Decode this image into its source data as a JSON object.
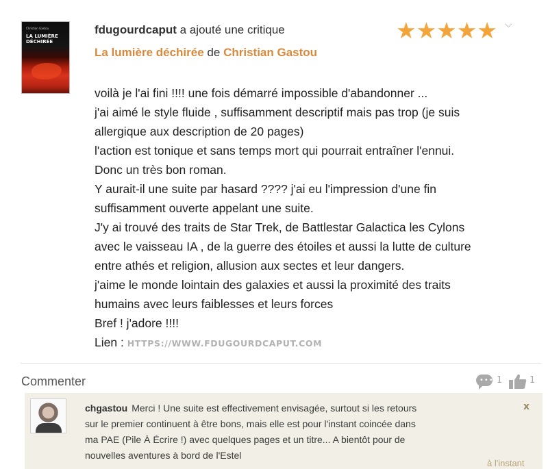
{
  "review": {
    "user": "fdugourdcaput",
    "action": "a ajouté une critique",
    "book_title": "La lumière déchirée",
    "de": "de",
    "author": "Christian Gastou",
    "rating": 5,
    "rating_max": 5,
    "stars": "★★★★★",
    "chevron": "⌵",
    "body_lines": [
      "voilà je l'ai fini !!!! une fois démarré impossible d'abandonner ...",
      "j'ai aimé le style fluide , suffisamment descriptif mais pas trop (je suis",
      "allergique aux description de 20 pages)",
      "l'action est tonique et sans temps mort qui pourrait entraîner l'ennui.",
      "Donc un très bon roman.",
      "Y aurait-il une suite par hasard ???? j'ai eu l'impression d'une fin",
      "suffisamment ouverte appelant une suite.",
      "J'y ai trouvé des traits de Star Trek, de Battlestar Galactica les Cylons",
      "avec le vaisseau IA , de la guerre des étoiles et aussi la lutte de culture",
      "entre athés et religion, allusion aux sectes et leur dangers.",
      "j'aime le monde lointain des galaxies et aussi la proximité des traits",
      "humains avec leurs faiblesses et leurs forces",
      "Bref ! j'adore !!!!"
    ],
    "link_label": "Lien :",
    "link_url": "HTTPS://WWW.FDUGOURDCAPUT.COM"
  },
  "cover": {
    "author": "Christian Gastou",
    "title": "LA LUMIÈRE DÉCHIRÉE"
  },
  "actions": {
    "comment_label": "Commenter",
    "comment_count": "1",
    "like_count": "1",
    "chat_icon": "speech-bubble-icon",
    "like_icon": "thumbs-up-icon"
  },
  "reply": {
    "author": "chgastou",
    "lines": [
      "Merci ! Une suite est effectivement envisagée, surtout si les retours",
      "sur le premier continuent à être bons, mais elle est pour l'instant coincée dans",
      "ma PAE (Pile À Écrire !) avec quelques pages et un titre... A bientôt pour de",
      "nouvelles aventures à bord de l'Estel"
    ],
    "close": "x",
    "time": "à l'instant"
  },
  "colors": {
    "accent": "#d9893d",
    "stars": "#f3a43a",
    "reply_bg": "#f1efe6"
  }
}
